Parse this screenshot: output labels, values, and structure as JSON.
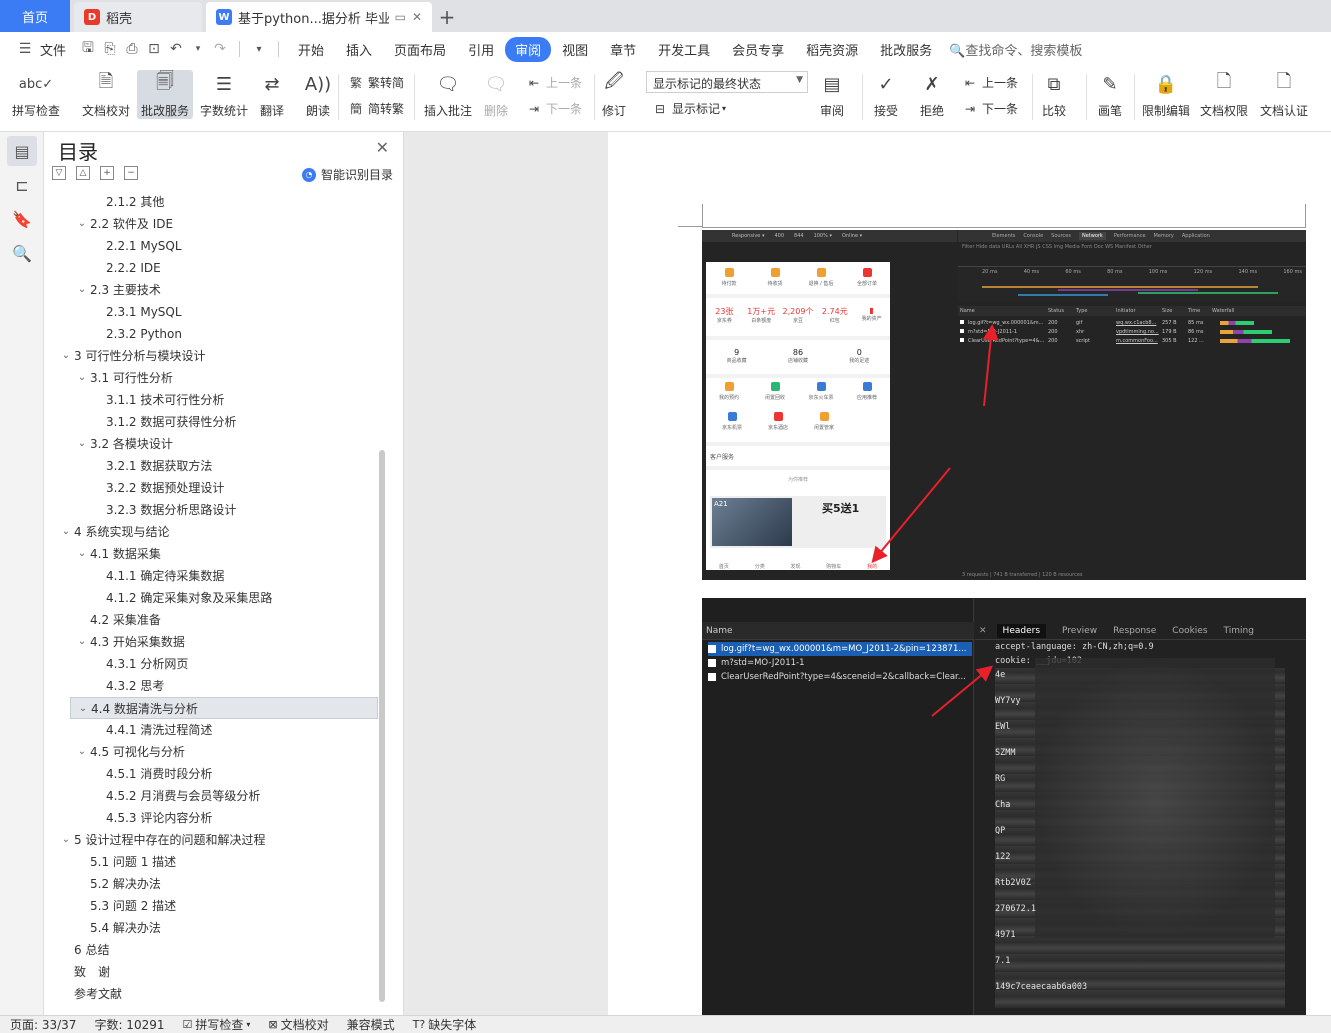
{
  "tabs": {
    "home": "首页",
    "daoke": "稻壳",
    "doc": "基于python...据分析 毕业论文"
  },
  "menu": {
    "file": "文件",
    "items": [
      "开始",
      "插入",
      "页面布局",
      "引用",
      "审阅",
      "视图",
      "章节",
      "开发工具",
      "会员专享",
      "稻壳资源",
      "批改服务"
    ],
    "active": "审阅",
    "search": "查找命令、搜索模板"
  },
  "ribbon": {
    "spell": "拼写检查",
    "doccheck": "文档校对",
    "review_service": "批改服务",
    "wordcount": "字数统计",
    "translate": "翻译",
    "read": "朗读",
    "to_trad": "繁转简",
    "to_simp": "简转繁",
    "insert_comment": "插入批注",
    "delete": "删除",
    "prev": "上一条",
    "next": "下一条",
    "revise": "修订",
    "markup_state": "显示标记的最终状态",
    "show_markup": "显示标记",
    "review": "审阅",
    "accept": "接受",
    "reject": "拒绝",
    "prev2": "上一条",
    "next2": "下一条",
    "compare": "比较",
    "pen": "画笔",
    "restrict": "限制编辑",
    "doc_perm": "文档权限",
    "doc_cert": "文档认证"
  },
  "toc": {
    "title": "目录",
    "smart": "智能识别目录",
    "items": [
      {
        "level": 3,
        "text": "2.1.2 其他"
      },
      {
        "level": 2,
        "text": "2.2 软件及 IDE",
        "exp": true
      },
      {
        "level": 3,
        "text": "2.2.1 MySQL"
      },
      {
        "level": 3,
        "text": "2.2.2 IDE"
      },
      {
        "level": 2,
        "text": "2.3 主要技术",
        "exp": true
      },
      {
        "level": 3,
        "text": "2.3.1 MySQL"
      },
      {
        "level": 3,
        "text": "2.3.2 Python"
      },
      {
        "level": 1,
        "text": "3 可行性分析与模块设计",
        "exp": true
      },
      {
        "level": 2,
        "text": "3.1 可行性分析",
        "exp": true
      },
      {
        "level": 3,
        "text": "3.1.1 技术可行性分析"
      },
      {
        "level": 3,
        "text": "3.1.2 数据可获得性分析"
      },
      {
        "level": 2,
        "text": "3.2 各模块设计",
        "exp": true
      },
      {
        "level": 3,
        "text": "3.2.1 数据获取方法"
      },
      {
        "level": 3,
        "text": "3.2.2 数据预处理设计"
      },
      {
        "level": 3,
        "text": "3.2.3 数据分析思路设计"
      },
      {
        "level": 1,
        "text": "4 系统实现与结论",
        "exp": true
      },
      {
        "level": 2,
        "text": "4.1 数据采集",
        "exp": true
      },
      {
        "level": 3,
        "text": "4.1.1 确定待采集数据"
      },
      {
        "level": 3,
        "text": "4.1.2 确定采集对象及采集思路"
      },
      {
        "level": 2,
        "text": "4.2 采集准备"
      },
      {
        "level": 2,
        "text": "4.3 开始采集数据",
        "exp": true
      },
      {
        "level": 3,
        "text": "4.3.1 分析网页"
      },
      {
        "level": 3,
        "text": "4.3.2 思考"
      },
      {
        "level": 2,
        "text": "4.4 数据清洗与分析",
        "exp": true,
        "sel": true
      },
      {
        "level": 3,
        "text": "4.4.1 清洗过程简述"
      },
      {
        "level": 2,
        "text": "4.5 可视化与分析",
        "exp": true
      },
      {
        "level": 3,
        "text": "4.5.1 消费时段分析"
      },
      {
        "level": 3,
        "text": "4.5.2 月消费与会员等级分析"
      },
      {
        "level": 3,
        "text": "4.5.3 评论内容分析"
      },
      {
        "level": 1,
        "text": "5 设计过程中存在的问题和解决过程",
        "exp": true
      },
      {
        "level": 2,
        "text": "5.1 问题 1 描述"
      },
      {
        "level": 2,
        "text": "5.2 解决办法"
      },
      {
        "level": 2,
        "text": "5.3 问题 2 描述"
      },
      {
        "level": 2,
        "text": "5.4 解决办法"
      },
      {
        "level": 1,
        "text": "6 总结"
      },
      {
        "level": 1,
        "text": "致　谢"
      },
      {
        "level": 1,
        "text": "参考文献"
      }
    ]
  },
  "shot1": {
    "toolbar": [
      "Responsive ▾",
      "400",
      "844",
      "100% ▾",
      "Online ▾"
    ],
    "phone_row1": [
      "待付款",
      "待收货",
      "退换 / 售后",
      "全部订单"
    ],
    "phone_row2": [
      {
        "v": "23张",
        "l": "京东券"
      },
      {
        "v": "1万+元",
        "l": "白条额度"
      },
      {
        "v": "2,209个",
        "l": "京豆"
      },
      {
        "v": "2.74元",
        "l": "红包"
      },
      {
        "v": "",
        "l": "我的资产"
      }
    ],
    "phone_row3": [
      {
        "n": "9",
        "l": "商品收藏"
      },
      {
        "n": "86",
        "l": "店铺收藏"
      },
      {
        "n": "0",
        "l": "我的足迹"
      }
    ],
    "phone_row4": [
      "我的预约",
      "闲置回收",
      "京东火车票",
      "应用推荐"
    ],
    "phone_row5": [
      "京东机票",
      "京东酒店",
      "闲置管家"
    ],
    "service": "客户服务",
    "recommend": "为你推荐",
    "promo_tag": "A21",
    "promo_text": "买5送1",
    "nav": [
      "首页",
      "分类",
      "发现",
      "购物车",
      "我的"
    ],
    "dt_tabs": [
      "Elements",
      "Console",
      "Sources",
      "Network",
      "Performance",
      "Memory",
      "Application"
    ],
    "dt_filter": "Filter      Hide data URLs   All   XHR  JS  CSS  Img  Media  Font  Doc  WS  Manifest  Other",
    "dt_times": [
      "20 ms",
      "40 ms",
      "60 ms",
      "80 ms",
      "100 ms",
      "120 ms",
      "140 ms",
      "160 ms"
    ],
    "dt_cols": [
      "Name",
      "Status",
      "Type",
      "Initiator",
      "Size",
      "Time",
      "Waterfall"
    ],
    "dt_rows": [
      [
        "log.gif?t=wg_wx.000001&m...",
        "200",
        "gif",
        "wq.wx.c1acb8...",
        "257 B",
        "85 ms"
      ],
      [
        "m?std=MO-J2011-1",
        "200",
        "xhr",
        "vpdtimming.no...",
        "179 B",
        "86 ms"
      ],
      [
        "ClearUserRedPoint?type=4&...",
        "200",
        "script",
        "m.commonFoo...",
        "305 B",
        "122 ..."
      ]
    ],
    "dt_status": "3 requests  |  741 B transferred  |  120 B resources"
  },
  "shot2": {
    "name_header": "Name",
    "items": [
      "log.gif?t=wg_wx.000001&m=MO_J2011-2&pin=123871...",
      "m?std=MO-J2011-1",
      "ClearUserRedPoint?type=4&sceneid=2&callback=Clear..."
    ],
    "tabs": [
      "Headers",
      "Preview",
      "Response",
      "Cookies",
      "Timing"
    ],
    "line1": "accept-language: zh-CN,zh;q=0.9",
    "line2": "cookie: __jdu=102",
    "frag": [
      "4e",
      "WY7vy",
      "EWl",
      "SZMM",
      "RG",
      "Cha",
      "QP",
      "122",
      "Rtb2V0Z",
      "270672.1",
      "4971",
      "7.1",
      "149c7ceaecaab6a003"
    ]
  },
  "status": {
    "page": "页面: 33/37",
    "words": "字数: 10291",
    "spell": "拼写检查",
    "doccheck": "文档校对",
    "compat": "兼容模式",
    "missing_font": "缺失字体"
  }
}
